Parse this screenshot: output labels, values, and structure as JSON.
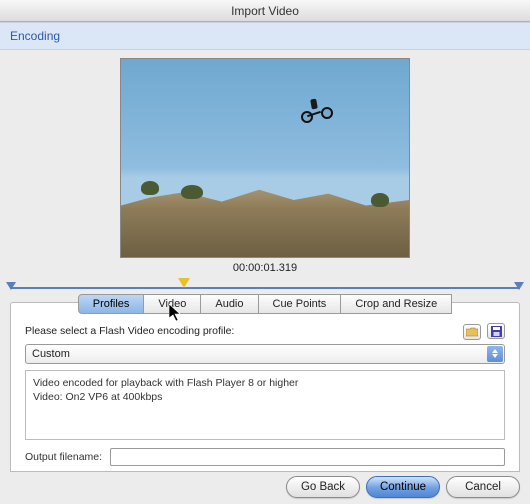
{
  "window": {
    "title": "Import Video"
  },
  "section": {
    "label": "Encoding"
  },
  "preview": {
    "timecode": "00:00:01.319"
  },
  "tabs": {
    "items": [
      {
        "label": "Profiles",
        "active": true
      },
      {
        "label": "Video"
      },
      {
        "label": "Audio"
      },
      {
        "label": "Cue Points"
      },
      {
        "label": "Crop and Resize"
      }
    ]
  },
  "profiles": {
    "prompt": "Please select a Flash Video encoding profile:",
    "open_icon": "folder-open-icon",
    "save_icon": "floppy-save-icon",
    "selected": "Custom",
    "description_line1": "Video encoded for playback with Flash Player 8 or higher",
    "description_line2": "Video: On2 VP6 at 400kbps",
    "output_label": "Output filename:",
    "output_value": ""
  },
  "buttons": {
    "go_back": "Go Back",
    "continue": "Continue",
    "cancel": "Cancel"
  }
}
